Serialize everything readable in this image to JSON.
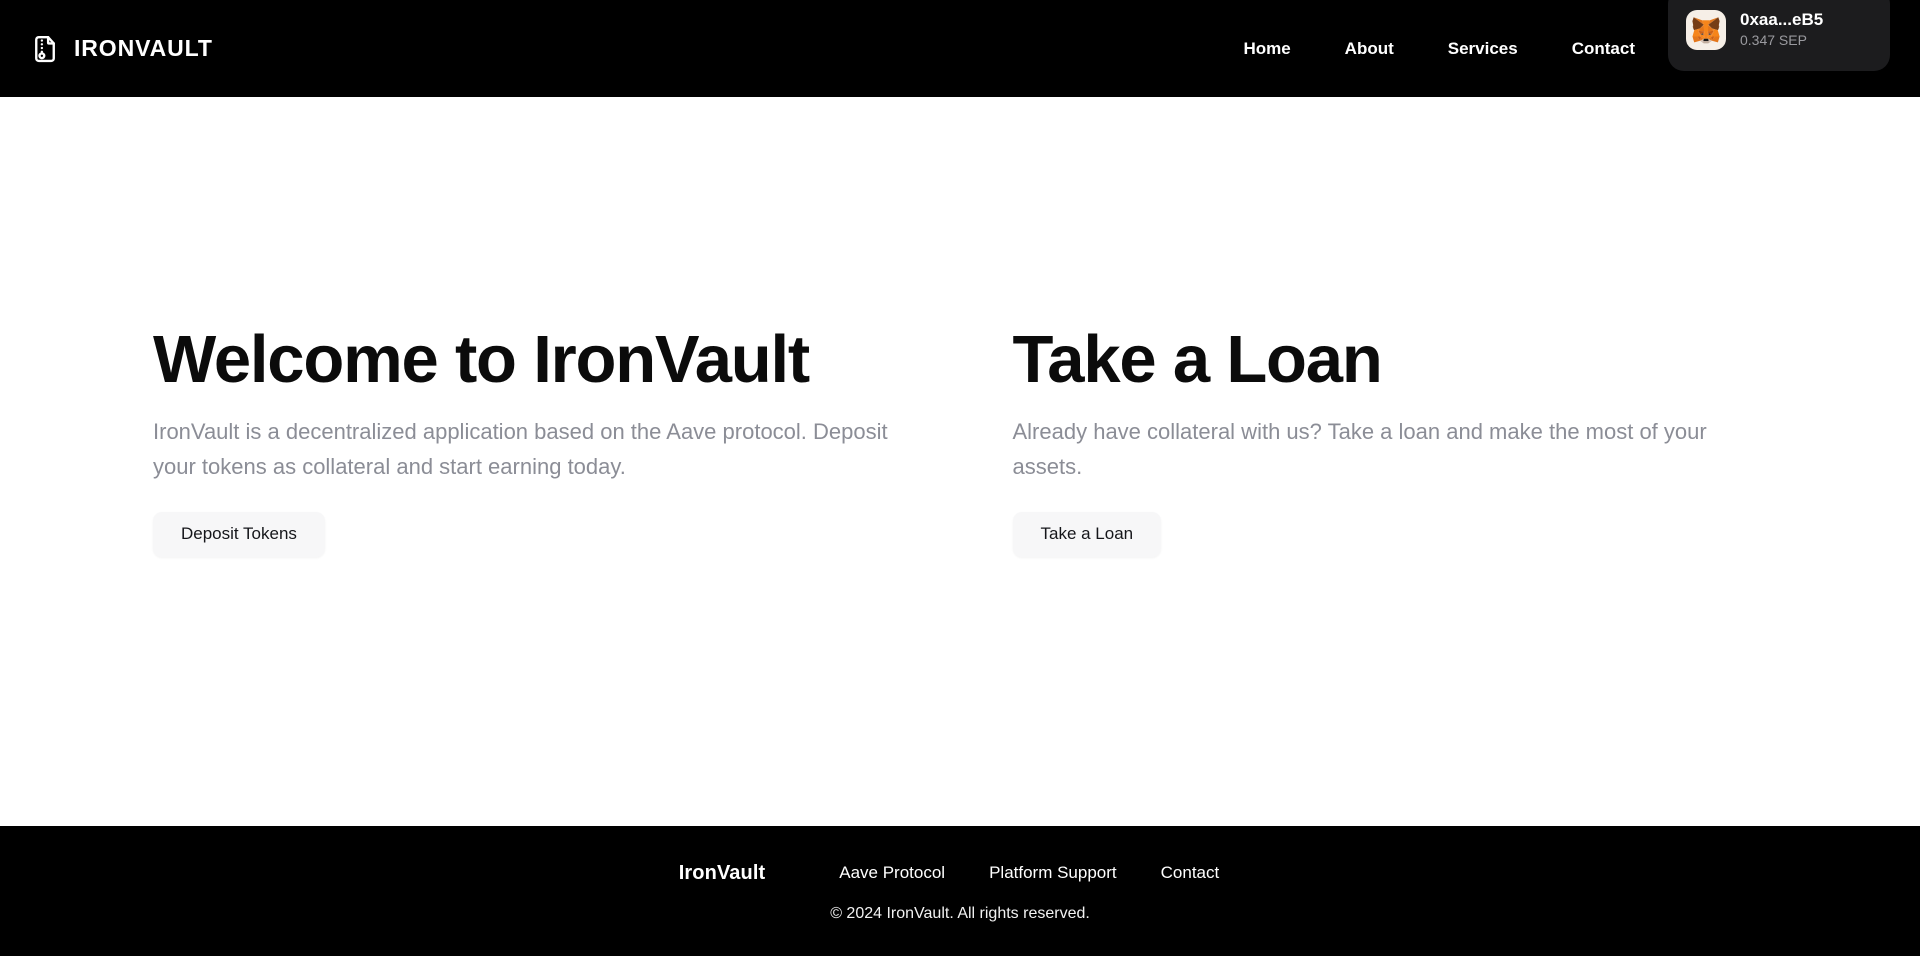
{
  "header": {
    "brand": {
      "icon": "file-archive-icon",
      "name": "IRONVAULT"
    },
    "nav": [
      {
        "label": "Home"
      },
      {
        "label": "About"
      },
      {
        "label": "Services"
      },
      {
        "label": "Contact"
      }
    ],
    "wallet": {
      "icon": "metamask-fox-icon",
      "address": "0xaa...eB5",
      "balance": "0.347 SEP"
    }
  },
  "main": {
    "panels": [
      {
        "title": "Welcome to IronVault",
        "subtitle": "IronVault is a decentralized application based on the Aave protocol. Deposit your tokens as collateral and start earning today.",
        "button_label": "Deposit Tokens"
      },
      {
        "title": "Take a Loan",
        "subtitle": "Already have collateral with us? Take a loan and make the most of your assets.",
        "button_label": "Take a Loan"
      }
    ]
  },
  "footer": {
    "brand": "IronVault",
    "links": [
      {
        "label": "Aave Protocol"
      },
      {
        "label": "Platform Support"
      },
      {
        "label": "Contact"
      }
    ],
    "copyright": "© 2024 IronVault. All rights reserved."
  },
  "colors": {
    "header_bg": "#000000",
    "page_bg": "#ffffff",
    "text_primary": "#0b0b0b",
    "text_muted": "#8b8d96",
    "button_bg": "#f7f7f8",
    "wallet_bg": "#1c1c1e",
    "metamask_orange": "#e2761b"
  }
}
